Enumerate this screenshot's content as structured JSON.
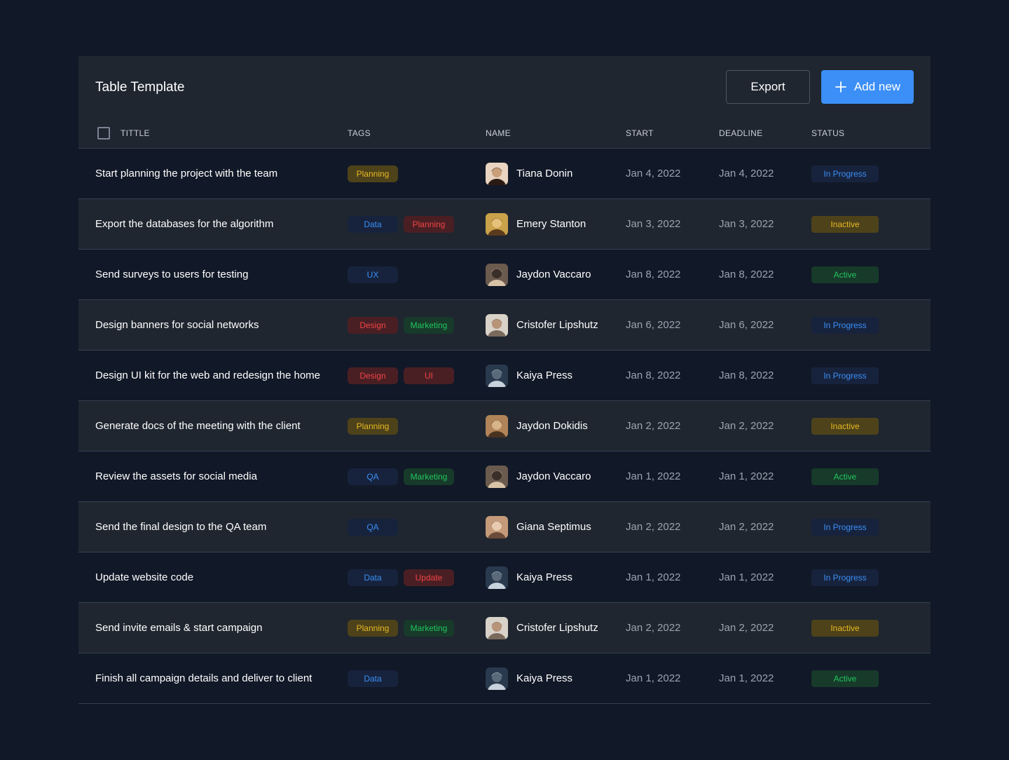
{
  "header": {
    "title": "Table Template",
    "export_label": "Export",
    "add_label": "Add new"
  },
  "columns": {
    "title": "TITTLE",
    "tags": "TAGS",
    "name": "NAME",
    "start": "START",
    "deadline": "DEADLINE",
    "status": "STATUS"
  },
  "colors": {
    "background": "#111827",
    "card": "#1f2630",
    "accent": "#3b8ff6",
    "tag_yellow": "#e8b923",
    "tag_blue": "#3b8ff6",
    "tag_red": "#ef4444",
    "tag_green": "#22c55e"
  },
  "rows": [
    {
      "title": "Start planning the project with the team",
      "tags": [
        {
          "label": "Planning",
          "color": "yellow"
        }
      ],
      "name": "Tiana Donin",
      "avatar": "avatar-photo",
      "start": "Jan 4, 2022",
      "deadline": "Jan 4, 2022",
      "status": {
        "label": "In Progress",
        "color": "blue"
      }
    },
    {
      "title": "Export the databases for the algorithm",
      "tags": [
        {
          "label": "Data",
          "color": "blue"
        },
        {
          "label": "Planning",
          "color": "red"
        }
      ],
      "name": "Emery Stanton",
      "avatar": "avatar-photo",
      "start": "Jan 3, 2022",
      "deadline": "Jan 3, 2022",
      "status": {
        "label": "Inactive",
        "color": "yellow"
      }
    },
    {
      "title": "Send surveys to users for testing",
      "tags": [
        {
          "label": "UX",
          "color": "blue"
        }
      ],
      "name": "Jaydon Vaccaro",
      "avatar": "avatar-photo",
      "start": "Jan 8, 2022",
      "deadline": "Jan 8, 2022",
      "status": {
        "label": "Active",
        "color": "green"
      }
    },
    {
      "title": "Design banners for social networks",
      "tags": [
        {
          "label": "Design",
          "color": "red"
        },
        {
          "label": "Marketing",
          "color": "green"
        }
      ],
      "name": "Cristofer Lipshutz",
      "avatar": "avatar-photo",
      "start": "Jan 6, 2022",
      "deadline": "Jan 6, 2022",
      "status": {
        "label": "In Progress",
        "color": "blue"
      }
    },
    {
      "title": "Design UI kit for the web and redesign the home",
      "tags": [
        {
          "label": "Design",
          "color": "red"
        },
        {
          "label": "UI",
          "color": "red"
        }
      ],
      "name": "Kaiya Press",
      "avatar": "avatar-photo",
      "start": "Jan 8, 2022",
      "deadline": "Jan 8, 2022",
      "status": {
        "label": "In Progress",
        "color": "blue"
      }
    },
    {
      "title": "Generate docs of the meeting with the client",
      "tags": [
        {
          "label": "Planning",
          "color": "yellow"
        }
      ],
      "name": "Jaydon Dokidis",
      "avatar": "avatar-photo",
      "start": "Jan 2, 2022",
      "deadline": "Jan 2, 2022",
      "status": {
        "label": "Inactive",
        "color": "yellow"
      }
    },
    {
      "title": "Review the assets for social media",
      "tags": [
        {
          "label": "QA",
          "color": "blue"
        },
        {
          "label": "Marketing",
          "color": "green"
        }
      ],
      "name": "Jaydon Vaccaro",
      "avatar": "avatar-photo",
      "start": "Jan 1, 2022",
      "deadline": "Jan 1, 2022",
      "status": {
        "label": "Active",
        "color": "green"
      }
    },
    {
      "title": "Send the final design to the QA team",
      "tags": [
        {
          "label": "QA",
          "color": "blue"
        }
      ],
      "name": "Giana Septimus",
      "avatar": "avatar-photo",
      "start": "Jan 2, 2022",
      "deadline": "Jan 2, 2022",
      "status": {
        "label": "In Progress",
        "color": "blue"
      }
    },
    {
      "title": "Update website code",
      "tags": [
        {
          "label": "Data",
          "color": "blue"
        },
        {
          "label": "Update",
          "color": "red"
        }
      ],
      "name": "Kaiya Press",
      "avatar": "avatar-photo",
      "start": "Jan 1, 2022",
      "deadline": "Jan 1, 2022",
      "status": {
        "label": "In Progress",
        "color": "blue"
      }
    },
    {
      "title": "Send invite emails & start campaign",
      "tags": [
        {
          "label": "Planning",
          "color": "yellow"
        },
        {
          "label": "Marketing",
          "color": "green"
        }
      ],
      "name": "Cristofer Lipshutz",
      "avatar": "avatar-photo",
      "start": "Jan 2, 2022",
      "deadline": "Jan 2, 2022",
      "status": {
        "label": "Inactive",
        "color": "yellow"
      }
    },
    {
      "title": "Finish all campaign details and deliver to client",
      "tags": [
        {
          "label": "Data",
          "color": "blue"
        }
      ],
      "name": "Kaiya Press",
      "avatar": "avatar-photo",
      "start": "Jan 1, 2022",
      "deadline": "Jan 1, 2022",
      "status": {
        "label": "Active",
        "color": "green"
      }
    }
  ]
}
